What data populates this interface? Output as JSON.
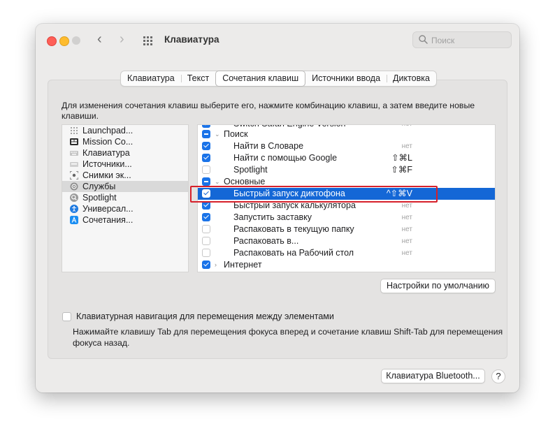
{
  "window": {
    "title": "Клавиатура"
  },
  "search": {
    "placeholder": "Поиск"
  },
  "tabs": [
    {
      "label": "Клавиатура",
      "active": false
    },
    {
      "label": "Текст",
      "active": false
    },
    {
      "label": "Сочетания клавиш",
      "active": true
    },
    {
      "label": "Источники ввода",
      "active": false
    },
    {
      "label": "Диктовка",
      "active": false
    }
  ],
  "description": "Для изменения сочетания клавиш выберите его, нажмите комбинацию клавиш, а затем введите новые клавиши.",
  "categories": [
    {
      "label": "Launchpad...",
      "icon": "launchpad-icon"
    },
    {
      "label": "Mission Co...",
      "icon": "mission-control-icon"
    },
    {
      "label": "Клавиатура",
      "icon": "keyboard-icon"
    },
    {
      "label": "Источники...",
      "icon": "input-sources-icon"
    },
    {
      "label": "Снимки эк...",
      "icon": "screenshot-icon"
    },
    {
      "label": "Службы",
      "icon": "gear-icon",
      "selected": true
    },
    {
      "label": "Spotlight",
      "icon": "spotlight-icon"
    },
    {
      "label": "Универсал...",
      "icon": "accessibility-icon"
    },
    {
      "label": "Сочетания...",
      "icon": "app-shortcuts-icon"
    }
  ],
  "shortcuts": [
    {
      "type": "item",
      "label": "Switch Safari Engine Version",
      "shortcut": "нет",
      "checkbox": "on",
      "cut": true
    },
    {
      "type": "group",
      "label": "Поиск",
      "checkbox": "mixed"
    },
    {
      "type": "item",
      "label": "Найти в Словаре",
      "shortcut": "нет",
      "checkbox": "on"
    },
    {
      "type": "item",
      "label": "Найти с помощью Google",
      "shortcut": "⇧⌘L",
      "checkbox": "on"
    },
    {
      "type": "item",
      "label": "Spotlight",
      "shortcut": "⇧⌘F",
      "checkbox": "off"
    },
    {
      "type": "group",
      "label": "Основные",
      "checkbox": "mixed"
    },
    {
      "type": "item",
      "label": "Быстрый запуск диктофона",
      "shortcut": "^⇧⌘V",
      "checkbox": "on",
      "selected": true
    },
    {
      "type": "item",
      "label": "Быстрый запуск калькулятора",
      "shortcut": "нет",
      "checkbox": "on"
    },
    {
      "type": "item",
      "label": "Запустить заставку",
      "shortcut": "нет",
      "checkbox": "on"
    },
    {
      "type": "item",
      "label": "Распаковать в текущую папку",
      "shortcut": "нет",
      "checkbox": "off"
    },
    {
      "type": "item",
      "label": "Распаковать в...",
      "shortcut": "нет",
      "checkbox": "off"
    },
    {
      "type": "item",
      "label": "Распаковать на Рабочий стол",
      "shortcut": "нет",
      "checkbox": "off"
    },
    {
      "type": "group",
      "label": "Интернет",
      "checkbox": "on"
    }
  ],
  "buttons": {
    "defaults": "Настройки по умолчанию",
    "bluetooth": "Клавиатура Bluetooth...",
    "help": "?"
  },
  "keyboard_navigation": {
    "label": "Клавиатурная навигация для перемещения между элементами",
    "checked": false,
    "hint": "Нажимайте клавишу Tab для перемещения фокуса вперед и сочетание клавиш Shift-Tab для перемещения фокуса назад."
  },
  "colors": {
    "selection": "#1467d6",
    "checkbox": "#1a73e8",
    "annotation": "#d6202a"
  }
}
